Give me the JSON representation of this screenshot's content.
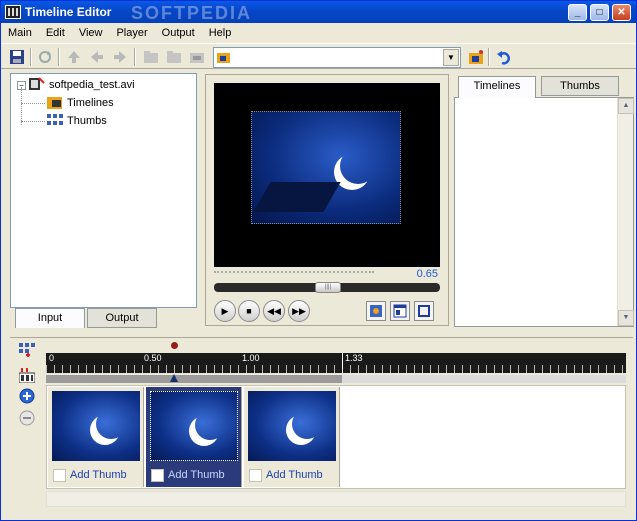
{
  "window": {
    "title": "Timeline Editor",
    "watermark": "SOFTPEDIA"
  },
  "menu": [
    "Main",
    "Edit",
    "View",
    "Player",
    "Output",
    "Help"
  ],
  "toolbar": {
    "combo_value": ""
  },
  "tree": {
    "root": "softpedia_test.avi",
    "children": [
      "Timelines",
      "Thumbs"
    ]
  },
  "left_tabs": {
    "input": "Input",
    "output": "Output"
  },
  "right_tabs": {
    "timelines": "Timelines",
    "thumbs": "Thumbs"
  },
  "player": {
    "position_text": "0.65",
    "position_fraction": 0.65,
    "accent": "#1c5ad8"
  },
  "ruler": {
    "labels": [
      "0",
      "0.50",
      "1.00",
      "1.33"
    ],
    "marker": 0.65
  },
  "thumbs": [
    {
      "label": "Add Thumb",
      "selected": false
    },
    {
      "label": "Add Thumb",
      "selected": true
    },
    {
      "label": "Add Thumb",
      "selected": false
    }
  ],
  "icons": {
    "save": "save-icon",
    "refresh": "refresh-icon",
    "up": "arrow-up-icon",
    "back": "arrow-left-icon",
    "forward": "arrow-right-icon",
    "folder": "folder-icon",
    "open": "open-folder-icon",
    "undo": "undo-icon"
  }
}
